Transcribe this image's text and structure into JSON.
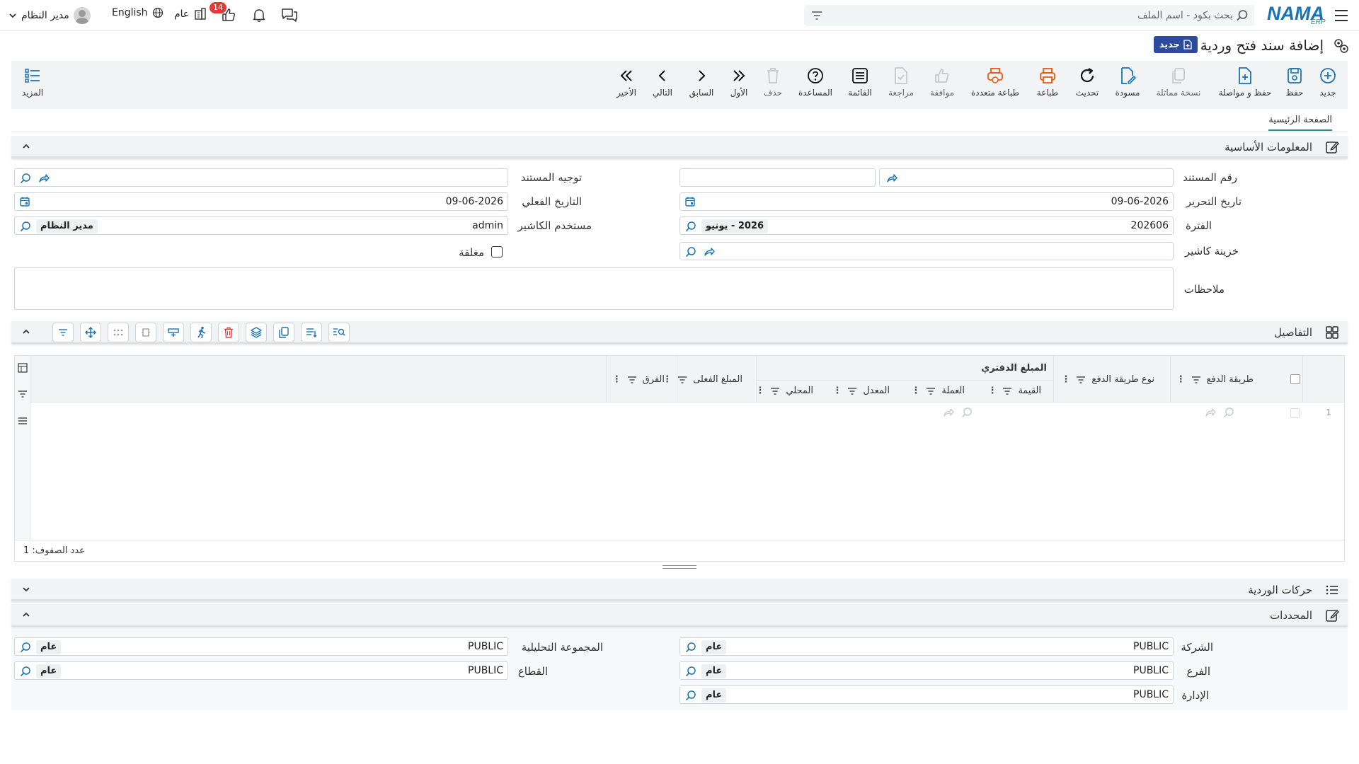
{
  "header": {
    "logo_text": "NAMA",
    "logo_sub": "ERP",
    "search_placeholder": "بحث بكود - اسم الملف",
    "language_label": "English",
    "user_name": "مدير النظام",
    "scope_label": "عام",
    "notif_count": "14"
  },
  "title": {
    "text": "إضافة سند فتح وردية",
    "badge": "جديد"
  },
  "toolbar": {
    "new": "جديد",
    "save": "حفظ",
    "save_continue": "حفظ و مواصلة",
    "copy": "نسخة مماثلة",
    "draft": "مسودة",
    "refresh": "تحديث",
    "print": "طباعة",
    "multi_print": "طباعة متعددة",
    "approve": "موافقة",
    "review": "مراجعة",
    "list": "القائمة",
    "help": "المساعدة",
    "delete": "حذف",
    "first": "الأول",
    "prev": "السابق",
    "next": "التالي",
    "last": "الأخير",
    "more": "المزيد"
  },
  "tabs": {
    "main": "الصفحة الرئيسية"
  },
  "basic_info": {
    "title": "المعلومات الأساسية",
    "doc_number_label": "رقم المستند",
    "doc_direction_label": "توجيه المستند",
    "edit_date_label": "تاريخ التحرير",
    "edit_date_value": "09-06-2026",
    "actual_date_label": "التاريخ الفعلي",
    "actual_date_value": "09-06-2026",
    "period_label": "الفترة",
    "period_value": "202606",
    "period_chip": "2026 - يونيو",
    "cashier_user_label": "مستخدم الكاشير",
    "cashier_user_value": "admin",
    "cashier_user_chip": "مدير النظام",
    "cashier_safe_label": "خزينة كاشير",
    "closed_label": "مغلقة",
    "notes_label": "ملاحظات"
  },
  "details": {
    "title": "التفاصيل",
    "columns": {
      "pay_method": "طريقة الدفع",
      "pay_type": "نوع طريقة الدفع",
      "book_amount": "المبلغ الدفتري",
      "value": "القيمة",
      "currency": "العملة",
      "rate": "المعدل",
      "local": "المحلي",
      "actual_amount": "المبلغ الفعلى",
      "diff": "الفرق"
    },
    "row_number": "1",
    "row_count": "عدد الصفوف: 1"
  },
  "shift_moves": {
    "title": "حركات الوردية"
  },
  "determinants": {
    "title": "المحددات",
    "company_label": "الشركة",
    "company_value": "PUBLIC",
    "company_chip": "عام",
    "branch_label": "الفرع",
    "branch_value": "PUBLIC",
    "branch_chip": "عام",
    "dept_label": "الإدارة",
    "dept_value": "PUBLIC",
    "dept_chip": "عام",
    "analysis_label": "المجموعة التحليلية",
    "analysis_value": "PUBLIC",
    "analysis_chip": "عام",
    "sector_label": "القطاع",
    "sector_value": "PUBLIC",
    "sector_chip": "عام"
  },
  "colors": {
    "accent": "#1a73b5",
    "teal": "#2a8c8c",
    "orange": "#e8590c",
    "badge_red": "#e53935",
    "badge_blue": "#2c4a9e"
  }
}
